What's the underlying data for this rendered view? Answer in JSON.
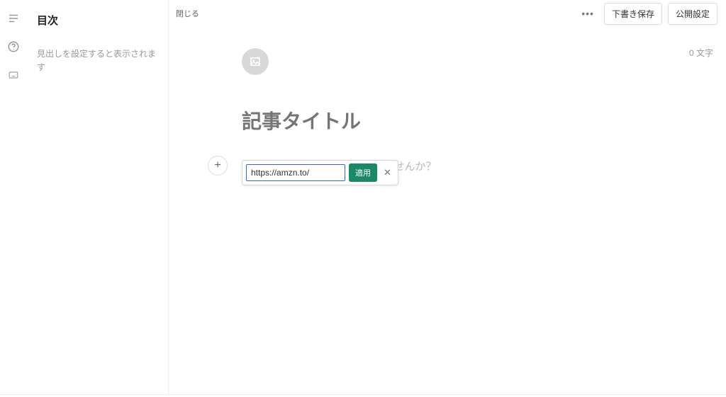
{
  "rail": {
    "icons": [
      "list-icon",
      "help-icon",
      "keyboard-icon"
    ]
  },
  "sidebar": {
    "title": "目次",
    "hint": "見出しを設定すると表示されます"
  },
  "topbar": {
    "close": "閉じる",
    "more": "•••",
    "save_draft": "下書き保存",
    "publish": "公開設定"
  },
  "editor": {
    "char_count": "0 文字",
    "title_placeholder": "記事タイトル",
    "body_placeholder": "ませんか？",
    "plus_label": "+"
  },
  "url_popover": {
    "value": "https://amzn.to/",
    "apply": "適用",
    "close": "✕"
  }
}
